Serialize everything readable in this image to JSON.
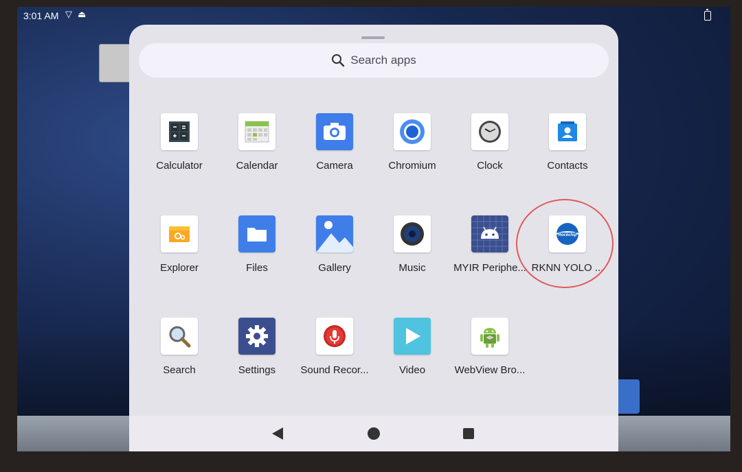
{
  "status_bar": {
    "time": "3:01 AM",
    "icons": [
      "vpn-shield-icon",
      "android-debug-icon",
      "battery-icon"
    ]
  },
  "search": {
    "placeholder": "Search apps",
    "icon": "search-icon"
  },
  "apps": [
    {
      "label": "Calculator",
      "icon": "calculator-icon"
    },
    {
      "label": "Calendar",
      "icon": "calendar-icon"
    },
    {
      "label": "Camera",
      "icon": "camera-icon"
    },
    {
      "label": "Chromium",
      "icon": "chromium-icon"
    },
    {
      "label": "Clock",
      "icon": "clock-icon"
    },
    {
      "label": "Contacts",
      "icon": "contacts-icon"
    },
    {
      "label": "Explorer",
      "icon": "explorer-icon"
    },
    {
      "label": "Files",
      "icon": "folder-icon"
    },
    {
      "label": "Gallery",
      "icon": "gallery-icon"
    },
    {
      "label": "Music",
      "icon": "speaker-icon"
    },
    {
      "label": "MYIR Periphe...",
      "icon": "android-grid-icon"
    },
    {
      "label": "RKNN YOLO ...",
      "icon": "rockchip-icon"
    },
    {
      "label": "Search",
      "icon": "magnifier-icon"
    },
    {
      "label": "Settings",
      "icon": "gear-icon"
    },
    {
      "label": "Sound Recor...",
      "icon": "microphone-icon"
    },
    {
      "label": "Video",
      "icon": "play-icon"
    },
    {
      "label": "WebView Bro...",
      "icon": "android-robot-icon"
    }
  ],
  "nav": {
    "back": "back-icon",
    "home": "home-icon",
    "recents": "recents-icon"
  },
  "colors": {
    "highlight": "#e05a5a",
    "drawer_bg": "#e5e3ea"
  }
}
